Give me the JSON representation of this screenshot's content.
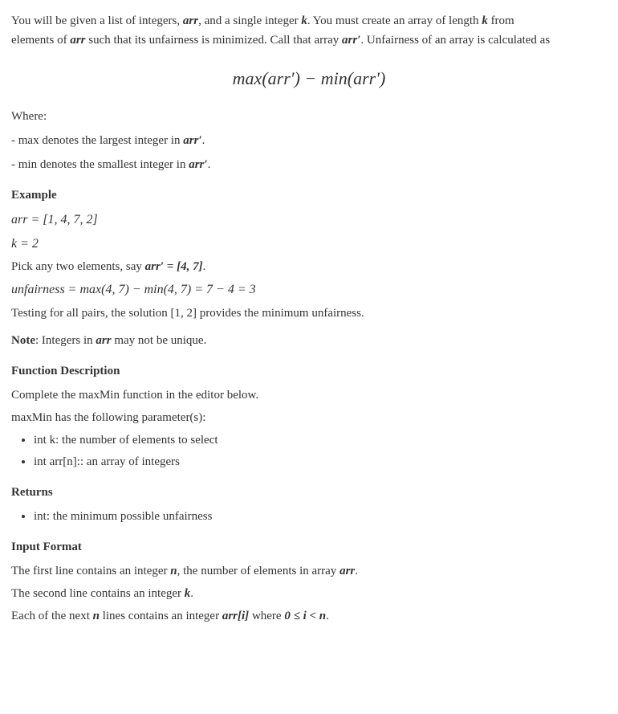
{
  "intro": {
    "text1": "You will be given a list of integers, ",
    "arr_italic": "arr",
    "text2": ", and a single integer ",
    "k_italic": "k",
    "text3": ". You must create an array of length ",
    "k_italic2": "k",
    "text_from": "from",
    "text4": "elements of ",
    "arr_italic2": "arr",
    "text5": " such that its unfairness is minimized. Call that array ",
    "arr_prime": "arr′",
    "text6": ". Unfairness of an array is calculated as"
  },
  "formula": {
    "display": "max(arr′) − min(arr′)"
  },
  "where": {
    "label": "Where:",
    "max_desc": "- max denotes the largest integer in ",
    "arr_prime_bold": "arr′",
    "period1": ".",
    "min_desc": "- min denotes the smallest integer in ",
    "arr_prime_bold2": "arr′",
    "period2": "."
  },
  "example": {
    "heading": "Example",
    "arr_eq": "arr = [1, 4, 7, 2]",
    "k_eq": "k = 2",
    "pick_text": "Pick any two elements, say ",
    "arr_prime_eq": "arr′ = [4, 7]",
    "period": ".",
    "unfairness_eq": "unfairness = max(4, 7) − min(4, 7) = 7 − 4 = 3",
    "testing_text1": "Testing for all pairs, the solution ",
    "bracket_12": "[1, 2]",
    "testing_text2": " provides the minimum unfairness."
  },
  "note": {
    "label": "Note",
    "text": ": Integers in ",
    "arr_italic": "arr",
    "text2": " may not be unique."
  },
  "function_desc": {
    "heading": "Function Description",
    "complete_text": "Complete the maxMin function in the editor below.",
    "params_text": "maxMin has the following parameter(s):",
    "params": [
      "int k: the number of elements to select",
      "int arr[n]:: an array of integers"
    ]
  },
  "returns": {
    "heading": "Returns",
    "items": [
      "int: the minimum possible unfairness"
    ]
  },
  "input_format": {
    "heading": "Input Format",
    "line1_text1": "The first line contains an integer ",
    "n_bold": "n",
    "line1_text2": ", the number of elements in array ",
    "arr_italic": "arr",
    "line1_period": ".",
    "line2_text1": "The second line contains an integer ",
    "k_bold": "k",
    "line2_period": ".",
    "line3_text1": "Each of the next ",
    "n_bold2": "n",
    "line3_text2": " lines contains an integer ",
    "arr_bracket": "arr[i]",
    "line3_text3": " where ",
    "inequality": "0 ≤ i < n",
    "line3_period": "."
  }
}
